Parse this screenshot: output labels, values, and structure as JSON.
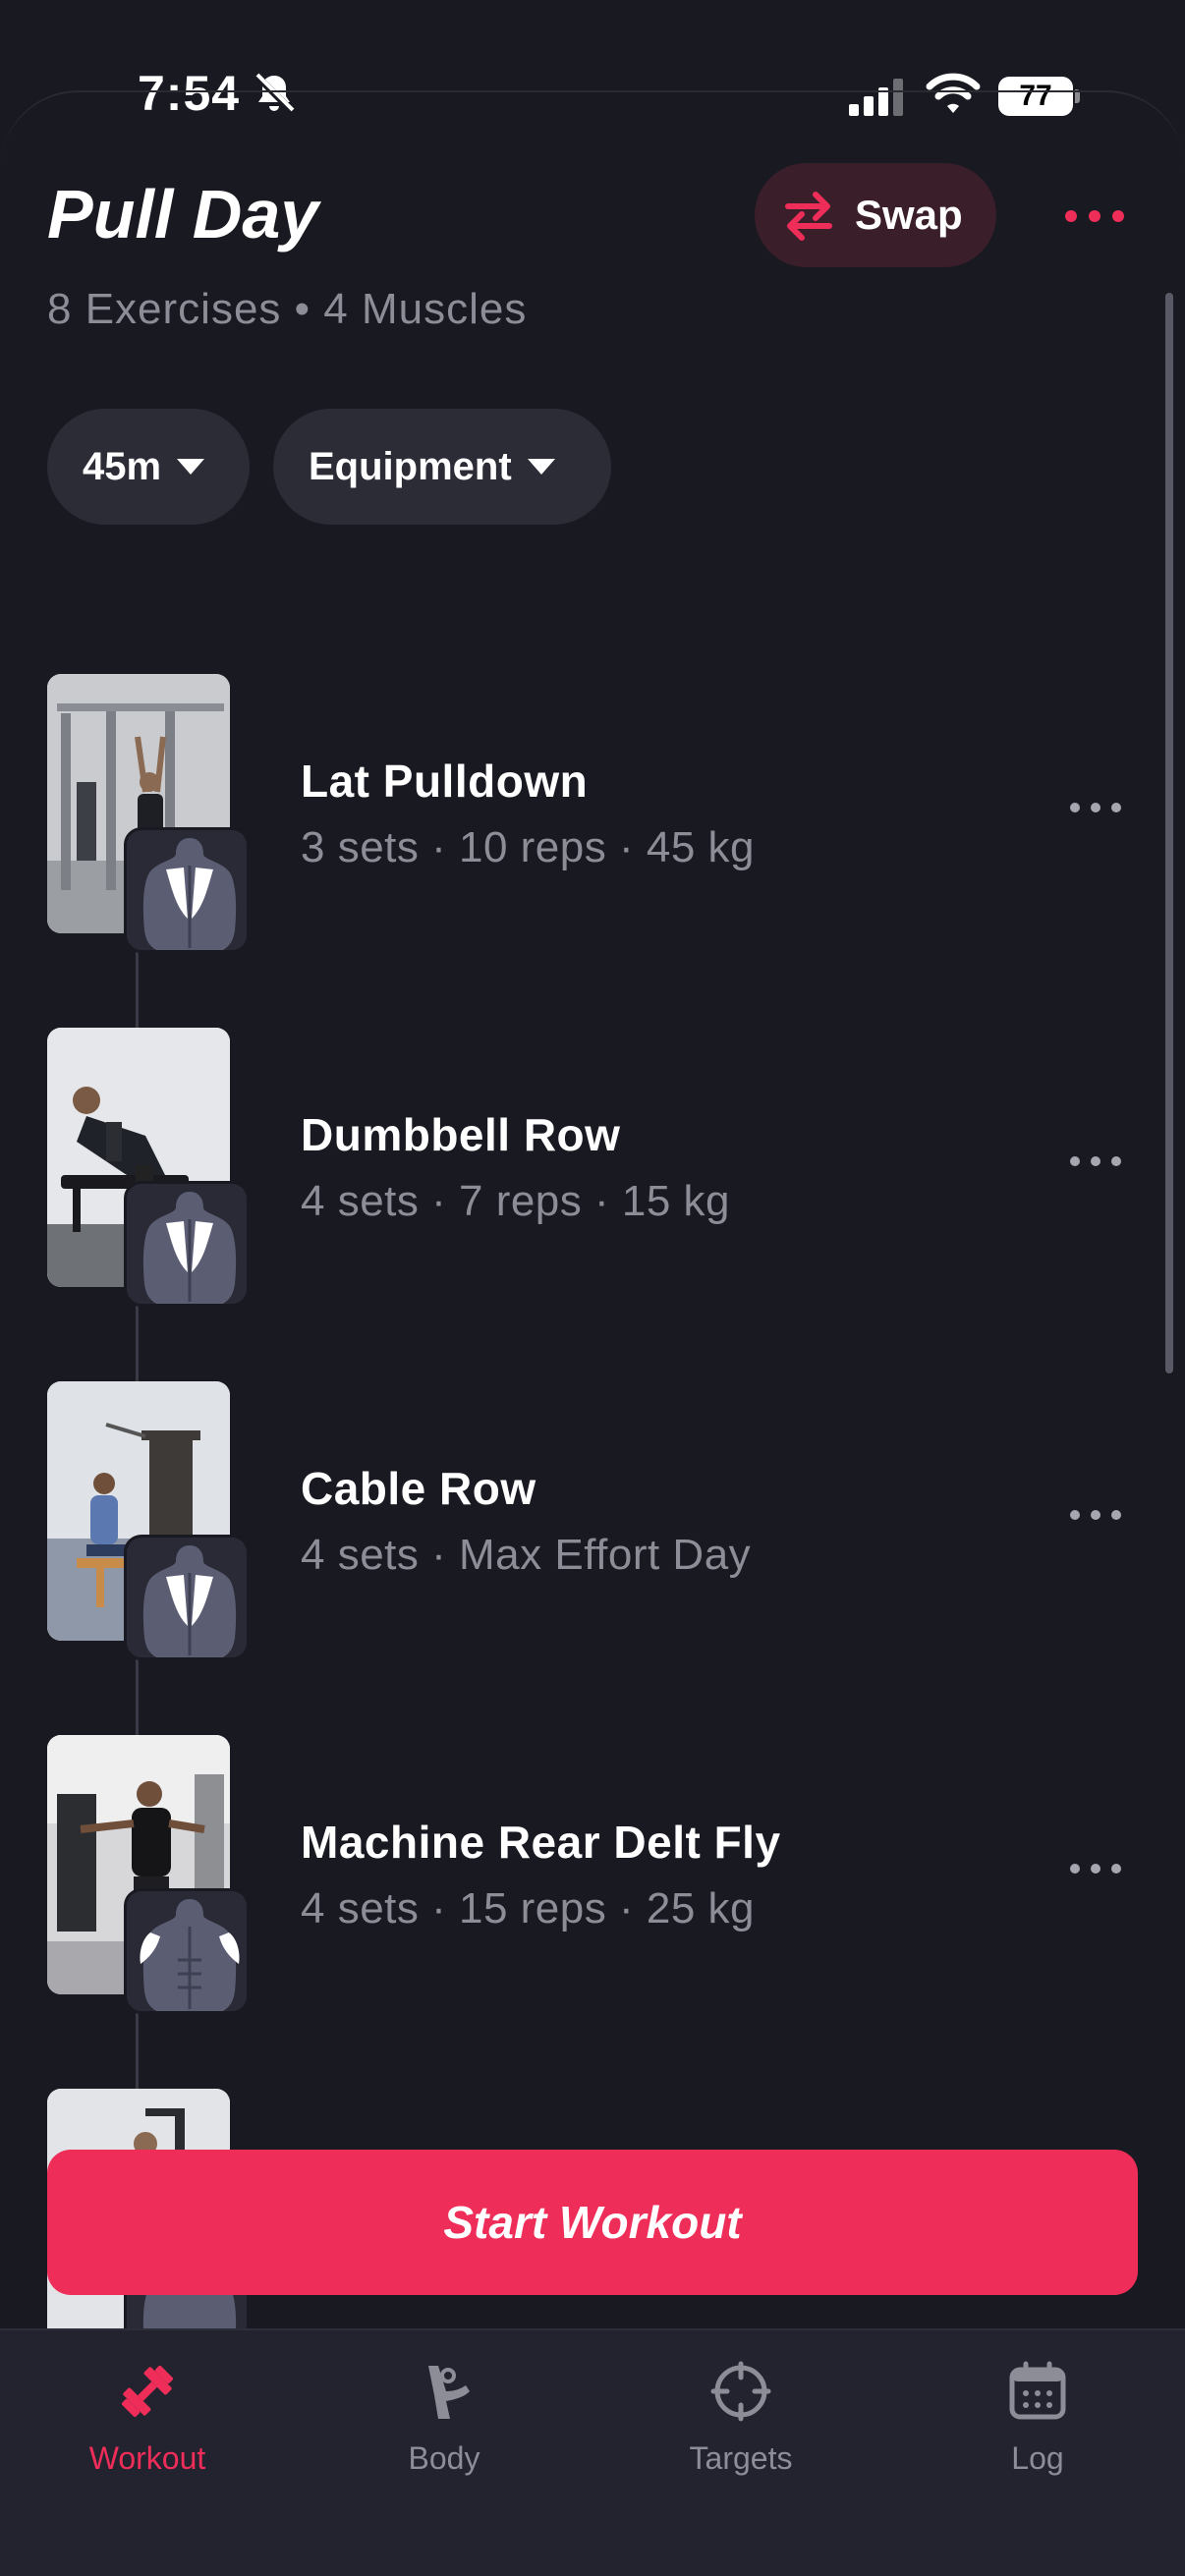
{
  "status_bar": {
    "time": "7:54",
    "battery": "77"
  },
  "header": {
    "title": "Pull Day",
    "subtitle": "8 Exercises • 4 Muscles",
    "swap_label": "Swap"
  },
  "filters": [
    {
      "label": "45m"
    },
    {
      "label": "Equipment"
    }
  ],
  "exercises": [
    {
      "name": "Lat Pulldown",
      "detail": "3 sets · 10 reps · 45 kg",
      "muscle": "back"
    },
    {
      "name": "Dumbbell Row",
      "detail": "4 sets · 7 reps · 15 kg",
      "muscle": "back"
    },
    {
      "name": "Cable Row",
      "detail": "4 sets · Max Effort Day",
      "muscle": "back"
    },
    {
      "name": "Machine Rear Delt Fly",
      "detail": "4 sets · 15 reps · 25 kg",
      "muscle": "rear-delts"
    }
  ],
  "start_button": {
    "label": "Start Workout"
  },
  "tabs": [
    {
      "label": "Workout",
      "icon": "dumbbell-icon",
      "active": true
    },
    {
      "label": "Body",
      "icon": "body-icon",
      "active": false
    },
    {
      "label": "Targets",
      "icon": "crosshair-icon",
      "active": false
    },
    {
      "label": "Log",
      "icon": "calendar-icon",
      "active": false
    }
  ],
  "colors": {
    "background": "#191922",
    "accent": "#ee2d58",
    "secondary_text": "#8d8d98",
    "chip": "#2c2c36",
    "tab_bar": "#232330"
  }
}
